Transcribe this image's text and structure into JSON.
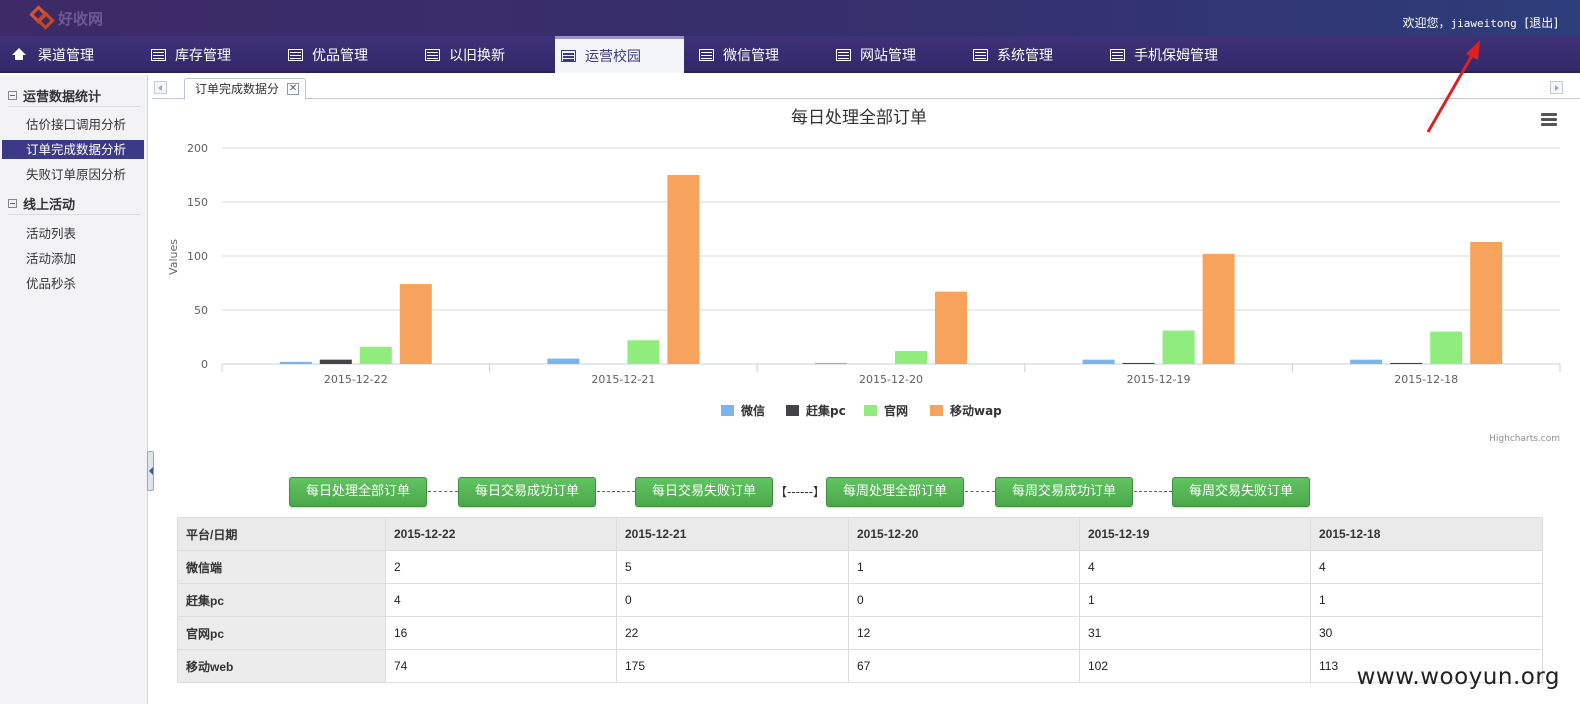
{
  "app": {
    "logo_text": "好收网",
    "welcome": "欢迎您，",
    "username": "jiaweitong",
    "logout": "[退出]"
  },
  "nav": [
    {
      "label": "渠道管理",
      "icon": "home-icon"
    },
    {
      "label": "库存管理",
      "icon": "table-icon"
    },
    {
      "label": "优品管理",
      "icon": "table-icon"
    },
    {
      "label": "以旧换新",
      "icon": "table-icon"
    },
    {
      "label": "运营校园",
      "icon": "table-icon",
      "active": true
    },
    {
      "label": "微信管理",
      "icon": "table-icon"
    },
    {
      "label": "网站管理",
      "icon": "table-icon"
    },
    {
      "label": "系统管理",
      "icon": "table-icon"
    },
    {
      "label": "手机保姆管理",
      "icon": "table-icon"
    }
  ],
  "sidebar": {
    "groups": [
      {
        "title": "运营数据统计",
        "items": [
          "估价接口调用分析",
          "订单完成数据分析",
          "失败订单原因分析"
        ]
      },
      {
        "title": "线上活动",
        "items": [
          "活动列表",
          "活动添加",
          "优品秒杀"
        ]
      }
    ],
    "active_item": "订单完成数据分析"
  },
  "tab": {
    "label": "订单完成数据分",
    "close": "✕"
  },
  "chart_data": {
    "type": "bar",
    "title": "每日处理全部订单",
    "ylabel": "Values",
    "ylim": [
      0,
      200
    ],
    "yticks": [
      0,
      50,
      100,
      150,
      200
    ],
    "categories": [
      "2015-12-22",
      "2015-12-21",
      "2015-12-20",
      "2015-12-19",
      "2015-12-18"
    ],
    "series": [
      {
        "name": "微信",
        "color": "#7cb5ec",
        "values": [
          2,
          5,
          1,
          4,
          4
        ]
      },
      {
        "name": "赶集pc",
        "color": "#434348",
        "values": [
          4,
          0,
          0,
          1,
          1
        ]
      },
      {
        "name": "官网",
        "color": "#90ed7d",
        "values": [
          16,
          22,
          12,
          31,
          30
        ]
      },
      {
        "name": "移动wap",
        "color": "#f7a35c",
        "values": [
          74,
          175,
          67,
          102,
          113
        ]
      }
    ],
    "legend": "bottom-center",
    "credits": "Highcharts.com"
  },
  "buttons": [
    "每日处理全部订单",
    "每日交易成功订单",
    "每日交易失败订单",
    "每周处理全部订单",
    "每周交易成功订单",
    "每周交易失败订单"
  ],
  "separator": "【------】",
  "table": {
    "headers": [
      "平台/日期",
      "2015-12-22",
      "2015-12-21",
      "2015-12-20",
      "2015-12-19",
      "2015-12-18"
    ],
    "rows": [
      {
        "label": "微信端",
        "values": [
          "2",
          "5",
          "1",
          "4",
          "4"
        ]
      },
      {
        "label": "赶集pc",
        "values": [
          "4",
          "0",
          "0",
          "1",
          "1"
        ]
      },
      {
        "label": "官网pc",
        "values": [
          "16",
          "22",
          "12",
          "31",
          "30"
        ]
      },
      {
        "label": "移动web",
        "values": [
          "74",
          "175",
          "67",
          "102",
          "113"
        ]
      }
    ]
  },
  "watermark": "www.wooyun.org"
}
